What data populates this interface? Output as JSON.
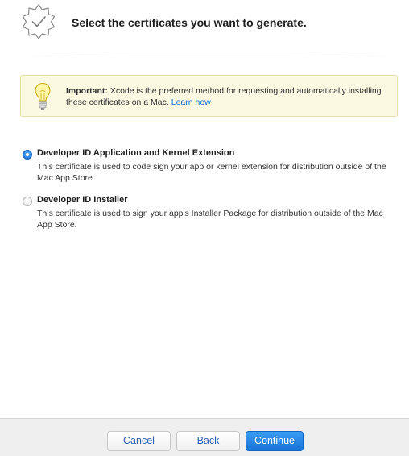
{
  "header": {
    "title": "Select the certificates you want to generate.",
    "icon": "certificate-badge-icon"
  },
  "notice": {
    "icon": "lightbulb-icon",
    "strong": "Important:",
    "text": " Xcode is the preferred method for requesting and automatically installing these certificates on a Mac. ",
    "link": "Learn how"
  },
  "options": [
    {
      "title": "Developer ID Application and Kernel Extension",
      "description": "This certificate is used to code sign your app or kernel extension for distribution outside of the Mac App Store.",
      "selected": true
    },
    {
      "title": "Developer ID Installer",
      "description": "This certificate is used to sign your app's Installer Package for distribution outside of the Mac App Store.",
      "selected": false
    }
  ],
  "footer": {
    "cancel": "Cancel",
    "back": "Back",
    "continue": "Continue"
  },
  "colors": {
    "accent": "#1873d6",
    "link": "#0d6fd0",
    "notice_bg": "#fcf9e2",
    "notice_border": "#e6dfaa",
    "footer_bg": "#efefef"
  }
}
